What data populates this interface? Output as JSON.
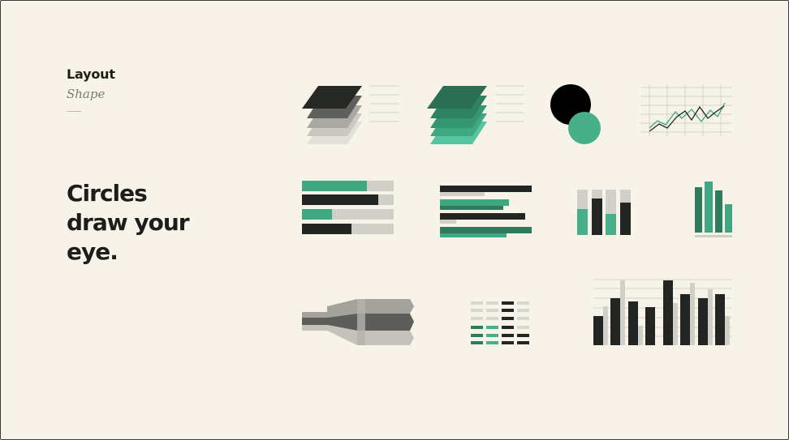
{
  "slide": {
    "section": "Layout",
    "subsection": "Shape",
    "headline_lines": [
      "Circles",
      "draw your",
      "eye."
    ]
  },
  "colors": {
    "background": "#f7f3e8",
    "dark": "#232522",
    "green": "#2e7b5f",
    "light_green": "#4fbf98",
    "gray": "#d0cfc8"
  },
  "icons": [
    "stacked-layers-dark-icon",
    "stacked-layers-green-icon",
    "overlapping-circles-icon",
    "line-chart-icon",
    "horizontal-progress-bars-icon",
    "horizontal-bar-pairs-icon",
    "stacked-columns-icon",
    "green-column-chart-icon",
    "funnel-arrow-icon",
    "grid-table-icon",
    "column-chart-icon"
  ]
}
